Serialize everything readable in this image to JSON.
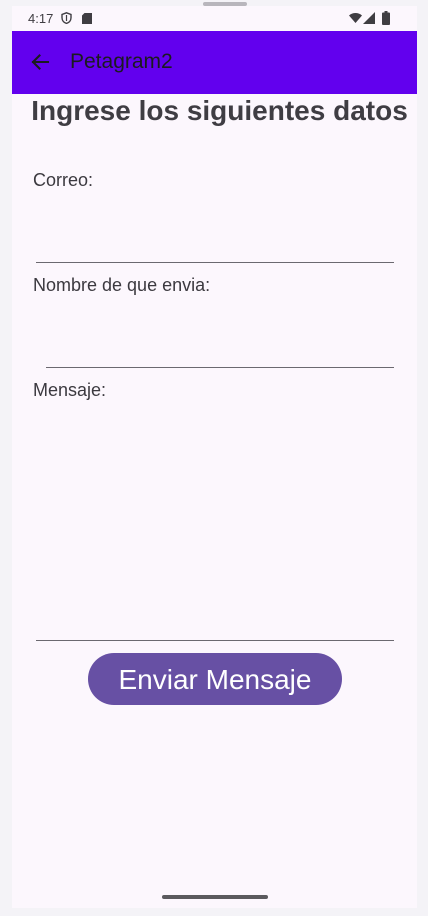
{
  "status_bar": {
    "time": "4:17",
    "icons": [
      "shield-icon",
      "sd-card-icon",
      "wifi-icon",
      "signal-icon",
      "battery-icon"
    ]
  },
  "app_bar": {
    "title": "Petagram2",
    "back_icon": "arrow-left-icon",
    "background": "#6200ee"
  },
  "form": {
    "heading": "Ingrese los siguientes datos",
    "fields": [
      {
        "label": "Correo:",
        "value": "",
        "placeholder": ""
      },
      {
        "label": "Nombre de que envia:",
        "value": "",
        "placeholder": ""
      },
      {
        "label": "Mensaje:",
        "value": "",
        "placeholder": ""
      }
    ],
    "submit_label": "Enviar Mensaje",
    "submit_color": "#6750a4"
  }
}
